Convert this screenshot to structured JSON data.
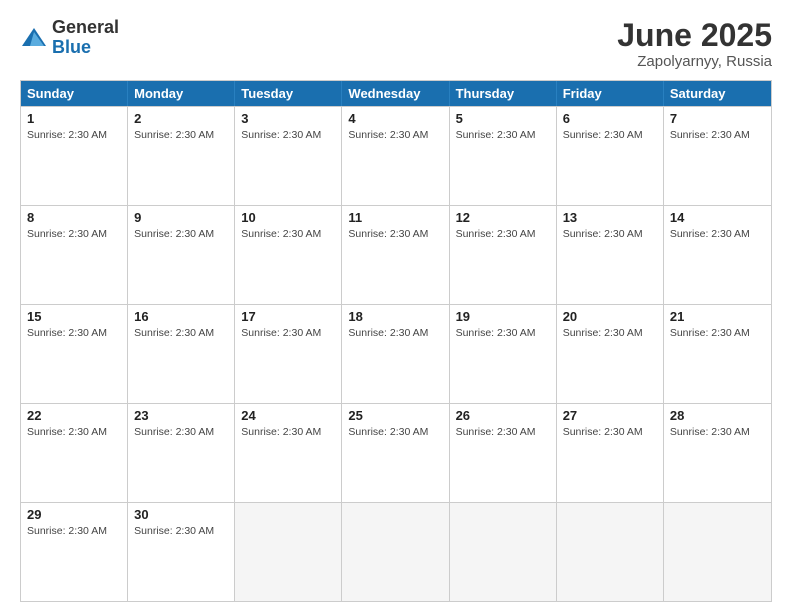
{
  "logo": {
    "general": "General",
    "blue": "Blue"
  },
  "header": {
    "month": "June 2025",
    "location": "Zapolyarnyy, Russia"
  },
  "weekdays": [
    "Sunday",
    "Monday",
    "Tuesday",
    "Wednesday",
    "Thursday",
    "Friday",
    "Saturday"
  ],
  "weeks": [
    [
      {
        "day": "1",
        "info": "Sunrise: 2:30 AM",
        "empty": false
      },
      {
        "day": "2",
        "info": "Sunrise: 2:30 AM",
        "empty": false
      },
      {
        "day": "3",
        "info": "Sunrise: 2:30 AM",
        "empty": false
      },
      {
        "day": "4",
        "info": "Sunrise: 2:30 AM",
        "empty": false
      },
      {
        "day": "5",
        "info": "Sunrise: 2:30 AM",
        "empty": false
      },
      {
        "day": "6",
        "info": "Sunrise: 2:30 AM",
        "empty": false
      },
      {
        "day": "7",
        "info": "Sunrise: 2:30 AM",
        "empty": false
      }
    ],
    [
      {
        "day": "8",
        "info": "Sunrise: 2:30 AM",
        "empty": false
      },
      {
        "day": "9",
        "info": "Sunrise: 2:30 AM",
        "empty": false
      },
      {
        "day": "10",
        "info": "Sunrise: 2:30 AM",
        "empty": false
      },
      {
        "day": "11",
        "info": "Sunrise: 2:30 AM",
        "empty": false
      },
      {
        "day": "12",
        "info": "Sunrise: 2:30 AM",
        "empty": false
      },
      {
        "day": "13",
        "info": "Sunrise: 2:30 AM",
        "empty": false
      },
      {
        "day": "14",
        "info": "Sunrise: 2:30 AM",
        "empty": false
      }
    ],
    [
      {
        "day": "15",
        "info": "Sunrise: 2:30 AM",
        "empty": false
      },
      {
        "day": "16",
        "info": "Sunrise: 2:30 AM",
        "empty": false
      },
      {
        "day": "17",
        "info": "Sunrise: 2:30 AM",
        "empty": false
      },
      {
        "day": "18",
        "info": "Sunrise: 2:30 AM",
        "empty": false
      },
      {
        "day": "19",
        "info": "Sunrise: 2:30 AM",
        "empty": false
      },
      {
        "day": "20",
        "info": "Sunrise: 2:30 AM",
        "empty": false
      },
      {
        "day": "21",
        "info": "Sunrise: 2:30 AM",
        "empty": false
      }
    ],
    [
      {
        "day": "22",
        "info": "Sunrise: 2:30 AM",
        "empty": false
      },
      {
        "day": "23",
        "info": "Sunrise: 2:30 AM",
        "empty": false
      },
      {
        "day": "24",
        "info": "Sunrise: 2:30 AM",
        "empty": false
      },
      {
        "day": "25",
        "info": "Sunrise: 2:30 AM",
        "empty": false
      },
      {
        "day": "26",
        "info": "Sunrise: 2:30 AM",
        "empty": false
      },
      {
        "day": "27",
        "info": "Sunrise: 2:30 AM",
        "empty": false
      },
      {
        "day": "28",
        "info": "Sunrise: 2:30 AM",
        "empty": false
      }
    ],
    [
      {
        "day": "29",
        "info": "Sunrise: 2:30 AM",
        "empty": false
      },
      {
        "day": "30",
        "info": "Sunrise: 2:30 AM",
        "empty": false
      },
      {
        "day": "",
        "info": "",
        "empty": true
      },
      {
        "day": "",
        "info": "",
        "empty": true
      },
      {
        "day": "",
        "info": "",
        "empty": true
      },
      {
        "day": "",
        "info": "",
        "empty": true
      },
      {
        "day": "",
        "info": "",
        "empty": true
      }
    ]
  ]
}
